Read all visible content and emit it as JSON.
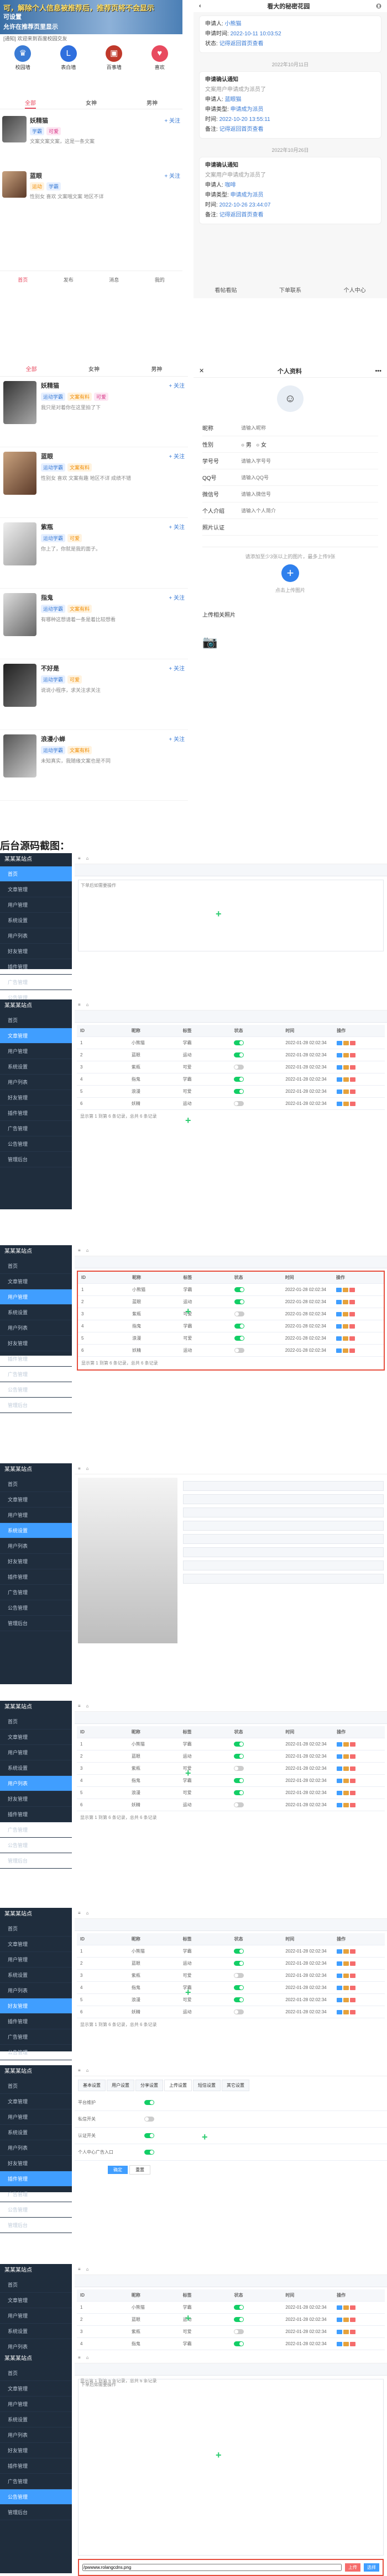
{
  "banner": {
    "line1": "可，解除个人信息被推荐后，推荐页将不会显示",
    "line2": "可设置",
    "line3": "允许在推荐页里显示"
  },
  "app1": {
    "notice": "[通知] 欢迎来到百度校园交友",
    "icons": [
      {
        "label": "校园墙",
        "color": "#3a7bd5",
        "glyph": "♛"
      },
      {
        "label": "表白墙",
        "color": "#2f6fde",
        "glyph": "L"
      },
      {
        "label": "百事墙",
        "color": "#c0392b",
        "glyph": "▣"
      },
      {
        "label": "喜欢",
        "color": "#e84a5f",
        "glyph": "♥"
      }
    ],
    "tabs": [
      "全部",
      "女神",
      "男神"
    ],
    "posts": [
      {
        "name": "妖精猫",
        "tags": [
          "学霸",
          "可爱"
        ],
        "text": "文案文案文案，这是一条文案",
        "follow": "+ 关注"
      },
      {
        "name": "蓝眼",
        "tags": [
          "运动",
          "学霸"
        ],
        "text": "性别女 喜欢 文案哦文案 地区不详",
        "follow": "+ 关注"
      }
    ],
    "bottom_nav": [
      "首页",
      "发布",
      "消息",
      "我的"
    ]
  },
  "app2": {
    "title": "看大的秘密花园",
    "items": [
      {
        "heading": "申请人:",
        "applicant": "小熊猫",
        "time_label": "申请时间:",
        "time": "2022-10-11 10:03:52",
        "status_label": "状态:",
        "status": "记得返回首页查看"
      },
      {
        "date": "2022年10月11日",
        "heading": "申请确认通知",
        "sub": "文案用户申请成为派员了",
        "applicant_label": "申请人:",
        "applicant": "蓝眼猫",
        "role_label": "申请类型:",
        "role": "申请成为派员",
        "time_label": "时间:",
        "time": "2022-10-20 13:55:11",
        "status_label": "备注:",
        "status": "记得返回首页查看"
      },
      {
        "date": "2022年10月26日",
        "heading": "申请确认通知",
        "sub": "文案用户申请成为派员了",
        "applicant_label": "申请人:",
        "applicant": "咖啡",
        "role_label": "申请类型:",
        "role": "申请成为派员",
        "time_label": "时间:",
        "time": "2022-10-26 23:44:07",
        "status_label": "备注:",
        "status": "记得返回首页查看"
      }
    ],
    "footer": [
      "看帖看贴",
      "下单联系",
      "个人中心"
    ]
  },
  "app3": {
    "tabs": [
      "全部",
      "女神",
      "男神"
    ],
    "posts": [
      {
        "name": "妖精猫",
        "text": "我只是对着你在这里拍了下",
        "tags": [
          "运动学霸",
          "文案有料",
          "可爱"
        ]
      },
      {
        "name": "蓝眼",
        "text": "性别女 喜欢 文案有趣 地区不详 成绩不错",
        "tags": [
          "运动学霸",
          "文案有料"
        ]
      },
      {
        "name": "紫瓶",
        "text": "你上了，你就是我的面子。",
        "tags": [
          "运动学霸",
          "可爱"
        ]
      },
      {
        "name": "指鬼",
        "text": "有哪种这想请着一条是着比较想看",
        "tags": [
          "运动学霸",
          "文案有料"
        ]
      },
      {
        "name": "不好是",
        "text": "说说小程序，求关注求关注",
        "tags": [
          "运动学霸",
          "可爱"
        ]
      },
      {
        "name": "浪漫小蝉",
        "text": "未知真实，我随缘文案也是不同",
        "tags": [
          "运动学霸",
          "文案有料"
        ]
      }
    ]
  },
  "app4": {
    "title": "个人资料",
    "fields": [
      "昵称",
      "性别",
      "学号号",
      "QQ号",
      "微信号",
      "个人介绍",
      "照片认证"
    ],
    "placeholders": [
      "请输入昵称",
      "",
      "请输入学号号",
      "请输入QQ号",
      "请输入微信号",
      "请输入个人简介",
      ""
    ],
    "gender": [
      "男",
      "女"
    ],
    "upload_label": "点击上传图片",
    "upload_hint": "请添加至少3张以上的图片，最多上传9张",
    "photo_label": "上传相关照片"
  },
  "section_title": "后台源码截图：",
  "admin": {
    "site": "某某某站点",
    "menu": [
      "首页",
      "文章管理",
      "用户管理",
      "系统设置",
      "用户列表",
      "好友管理",
      "插件管理",
      "广告管理",
      "公告管理",
      "管理后台"
    ],
    "table_rows": [
      {
        "id": "1",
        "name": "小熊猫",
        "tag": "学霸",
        "time": "2022-01-28 02:02:34"
      },
      {
        "id": "2",
        "name": "蓝眼",
        "tag": "运动",
        "time": "2022-01-28 02:02:34"
      },
      {
        "id": "3",
        "name": "紫瓶",
        "tag": "可爱",
        "time": "2022-01-28 02:02:34"
      },
      {
        "id": "4",
        "name": "指鬼",
        "tag": "学霸",
        "time": "2022-01-28 02:02:34"
      },
      {
        "id": "5",
        "name": "浪漫",
        "tag": "可爱",
        "time": "2022-01-28 02:02:34"
      },
      {
        "id": "6",
        "name": "妖精",
        "tag": "运动",
        "time": "2022-01-28 02:02:34"
      }
    ],
    "pager": "显示第 1 到第 6 条记录，总共 6 条记录",
    "editor_hint": "下单后如需要操作",
    "settings_tabs": [
      "基本设置",
      "用户设置",
      "分享设置",
      "上传设置",
      "短信设置",
      "其它设置"
    ],
    "settings_rows": [
      "平台维护",
      "私信开关",
      "认证开关",
      "个人中心广告入口"
    ],
    "save": "确定",
    "cancel": "重置",
    "upload_placeholder": "/pwwww.rolangcdns.png",
    "upload_btn": "上传",
    "select_btn": "选择"
  }
}
